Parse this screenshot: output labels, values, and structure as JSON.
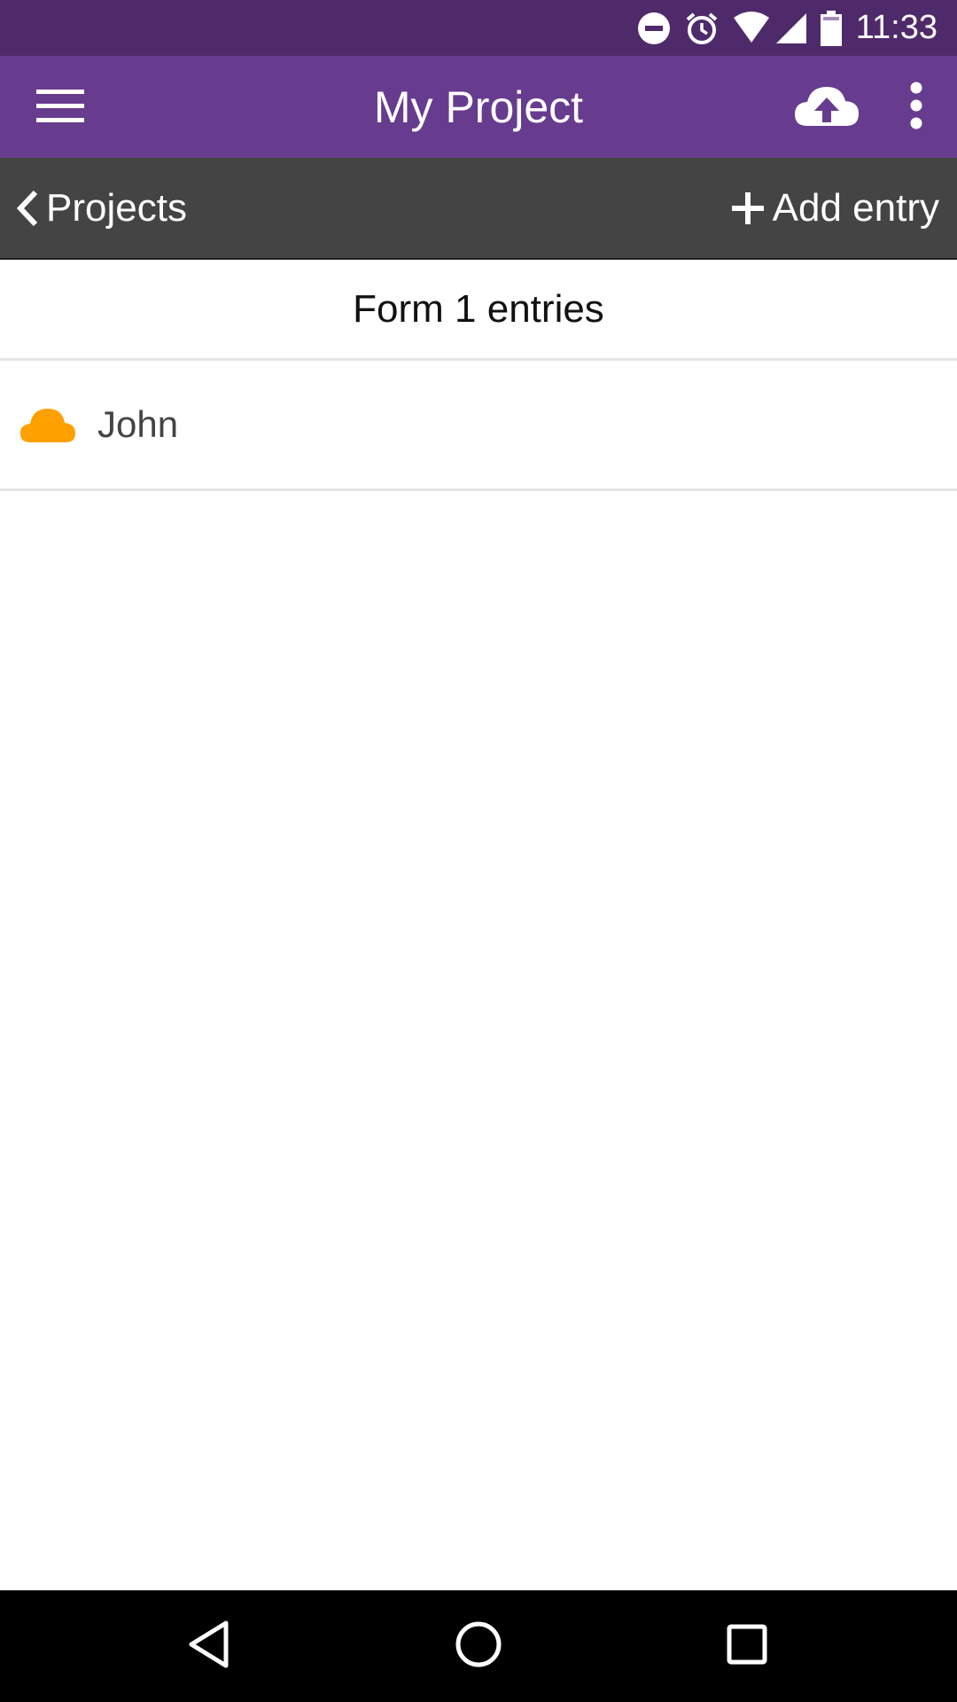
{
  "status_bar": {
    "time": "11:33",
    "icons": [
      "do-not-disturb-icon",
      "alarm-icon",
      "wifi-icon",
      "cell-signal-icon",
      "battery-icon"
    ],
    "background": "#4e2a6b"
  },
  "app_bar": {
    "title": "My Project",
    "background": "#673c8e",
    "icons": {
      "menu": "menu-icon",
      "upload": "cloud-upload-icon",
      "overflow": "more-vert-icon"
    }
  },
  "sub_bar": {
    "back_label": "Projects",
    "add_label": "Add entry",
    "background": "#444444"
  },
  "section": {
    "title": "Form 1 entries"
  },
  "entries": [
    {
      "name": "John",
      "status_icon": "cloud-icon",
      "status_color": "#ffa000"
    }
  ],
  "nav_bar": {
    "icons": [
      "back-icon",
      "home-icon",
      "recents-icon"
    ]
  }
}
